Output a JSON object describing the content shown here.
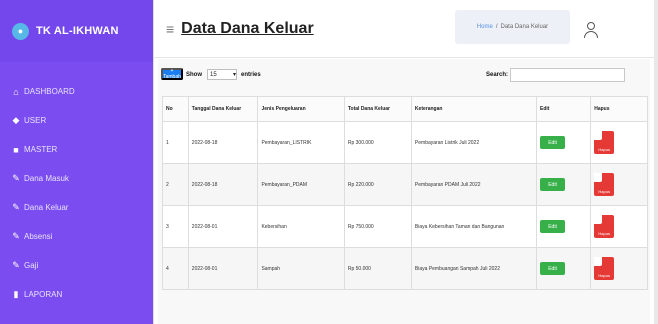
{
  "brand": {
    "title": "TK AL-IKHWAN"
  },
  "sidebar": {
    "items": [
      {
        "label": "DASHBOARD",
        "icon": "house-icon",
        "glyph": "⌂"
      },
      {
        "label": "USER",
        "icon": "users-icon",
        "glyph": "◆"
      },
      {
        "label": "MASTER",
        "icon": "folder-icon",
        "glyph": "■"
      },
      {
        "label": "Dana Masuk",
        "icon": "edit-icon",
        "glyph": "✎"
      },
      {
        "label": "Dana Keluar",
        "icon": "edit-icon",
        "glyph": "✎"
      },
      {
        "label": "Absensi",
        "icon": "edit-icon",
        "glyph": "✎"
      },
      {
        "label": "Gaji",
        "icon": "edit-icon",
        "glyph": "✎"
      },
      {
        "label": "LAPORAN",
        "icon": "document-icon",
        "glyph": "▮"
      }
    ]
  },
  "header": {
    "menu_icon": "≡",
    "title": "Data Dana Keluar",
    "breadcrumb": {
      "home": "Home",
      "separator": "/",
      "current": "Data Dana Keluar"
    }
  },
  "controls": {
    "add_label": "+ Tambah",
    "show_label": "Show",
    "entries_value": "15",
    "entries_label": "entries",
    "search_label": "Search:"
  },
  "table": {
    "headers": [
      "No",
      "Tanggal Dana Keluar",
      "Jenis Pengeluaran",
      "Total Dana Keluar",
      "Keterangan",
      "Edit",
      "Hapus"
    ],
    "rows": [
      {
        "no": "1",
        "date": "2022-08-18",
        "type": "Pembayaran_LISTRIK",
        "total": "Rp 300.000",
        "desc": "Pembayaran Listrik Juli 2022",
        "edit": "Edit",
        "delete": "Hapus"
      },
      {
        "no": "2",
        "date": "2022-08-18",
        "type": "Pembayaran_PDAM",
        "total": "Rp 220.000",
        "desc": "Pembayaran PDAM Juli 2022",
        "edit": "Edit",
        "delete": "Hapus"
      },
      {
        "no": "3",
        "date": "2022-08-01",
        "type": "Kebersihan",
        "total": "Rp 750.000",
        "desc": "Biaya Kebersihan Taman dan Bangunan",
        "edit": "Edit",
        "delete": "Hapus"
      },
      {
        "no": "4",
        "date": "2022-08-01",
        "type": "Sampah",
        "total": "Rp 50.000",
        "desc": "Biaya Pembuangan Sampah Juli 2022",
        "edit": "Edit",
        "delete": "Hapus"
      }
    ]
  },
  "colors": {
    "sidebar": "#7b4cf0",
    "primary": "#1b7ef0",
    "edit": "#37b04a",
    "delete": "#e53935"
  }
}
